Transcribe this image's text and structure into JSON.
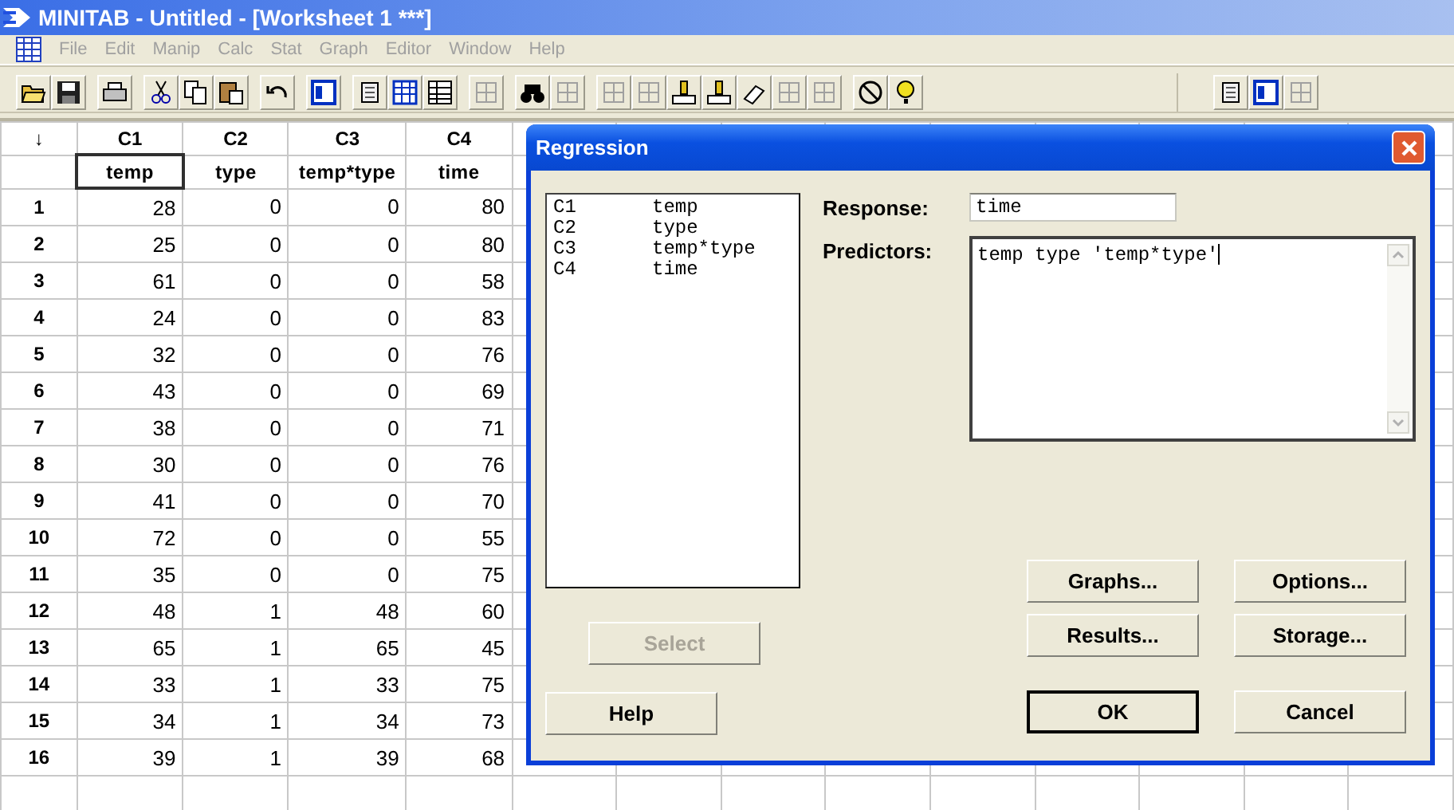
{
  "window": {
    "title": "MINITAB - Untitled - [Worksheet 1 ***]"
  },
  "menu": [
    "File",
    "Edit",
    "Manip",
    "Calc",
    "Stat",
    "Graph",
    "Editor",
    "Window",
    "Help"
  ],
  "worksheet": {
    "corner": "↓",
    "columns": [
      {
        "id": "C1",
        "name": "temp",
        "selected": true
      },
      {
        "id": "C2",
        "name": "type",
        "selected": false
      },
      {
        "id": "C3",
        "name": "temp*type",
        "selected": false
      },
      {
        "id": "C4",
        "name": "time",
        "selected": false
      }
    ],
    "rows": [
      {
        "num": "1",
        "cells": [
          "28",
          "0",
          "0",
          "80"
        ]
      },
      {
        "num": "2",
        "cells": [
          "25",
          "0",
          "0",
          "80"
        ]
      },
      {
        "num": "3",
        "cells": [
          "61",
          "0",
          "0",
          "58"
        ]
      },
      {
        "num": "4",
        "cells": [
          "24",
          "0",
          "0",
          "83"
        ]
      },
      {
        "num": "5",
        "cells": [
          "32",
          "0",
          "0",
          "76"
        ]
      },
      {
        "num": "6",
        "cells": [
          "43",
          "0",
          "0",
          "69"
        ]
      },
      {
        "num": "7",
        "cells": [
          "38",
          "0",
          "0",
          "71"
        ]
      },
      {
        "num": "8",
        "cells": [
          "30",
          "0",
          "0",
          "76"
        ]
      },
      {
        "num": "9",
        "cells": [
          "41",
          "0",
          "0",
          "70"
        ]
      },
      {
        "num": "10",
        "cells": [
          "72",
          "0",
          "0",
          "55"
        ]
      },
      {
        "num": "11",
        "cells": [
          "35",
          "0",
          "0",
          "75"
        ]
      },
      {
        "num": "12",
        "cells": [
          "48",
          "1",
          "48",
          "60"
        ]
      },
      {
        "num": "13",
        "cells": [
          "65",
          "1",
          "65",
          "45"
        ]
      },
      {
        "num": "14",
        "cells": [
          "33",
          "1",
          "33",
          "75"
        ]
      },
      {
        "num": "15",
        "cells": [
          "34",
          "1",
          "34",
          "73"
        ]
      },
      {
        "num": "16",
        "cells": [
          "39",
          "1",
          "39",
          "68"
        ]
      }
    ]
  },
  "dialog": {
    "title": "Regression",
    "variables": [
      {
        "column": "C1",
        "name": "temp"
      },
      {
        "column": "C2",
        "name": "type"
      },
      {
        "column": "C3",
        "name": "temp*type"
      },
      {
        "column": "C4",
        "name": "time"
      }
    ],
    "response": {
      "label": "Response:",
      "value": "time"
    },
    "predictors": {
      "label": "Predictors:",
      "value": "temp type 'temp*type'"
    },
    "buttons": [
      {
        "label": "Select",
        "disabled": true,
        "default": false
      },
      {
        "label": "Help",
        "disabled": false,
        "default": false
      },
      {
        "label": "Graphs...",
        "disabled": false,
        "default": false
      },
      {
        "label": "Options...",
        "disabled": false,
        "default": false
      },
      {
        "label": "Results...",
        "disabled": false,
        "default": false
      },
      {
        "label": "Storage...",
        "disabled": false,
        "default": false
      },
      {
        "label": "OK",
        "disabled": false,
        "default": true
      },
      {
        "label": "Cancel",
        "disabled": false,
        "default": false
      }
    ]
  }
}
